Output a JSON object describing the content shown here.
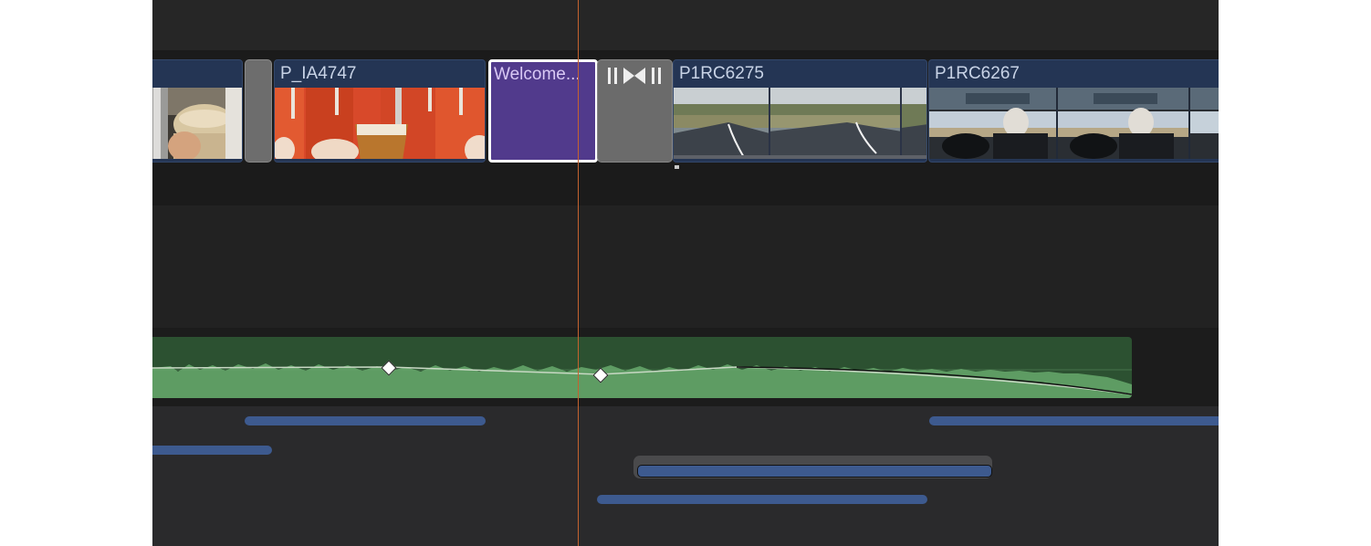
{
  "timeline": {
    "clips": [
      {
        "id": "clip-a",
        "name": ""
      },
      {
        "id": "clip-b",
        "name": "P_IA4747"
      },
      {
        "id": "clip-c",
        "name": "P1RC6275"
      },
      {
        "id": "clip-d",
        "name": "P1RC6267"
      }
    ],
    "title_clip": {
      "name": "Welcome..."
    },
    "transition": {
      "icon": "cross-dissolve-icon"
    }
  },
  "colors": {
    "playhead": "#c4622f",
    "video_clip": "#243554",
    "title_clip": "#513a8c",
    "audio_clip": "#2c5131",
    "waveform": "#5e9c63",
    "connected_clip": "#3d5a8f"
  }
}
